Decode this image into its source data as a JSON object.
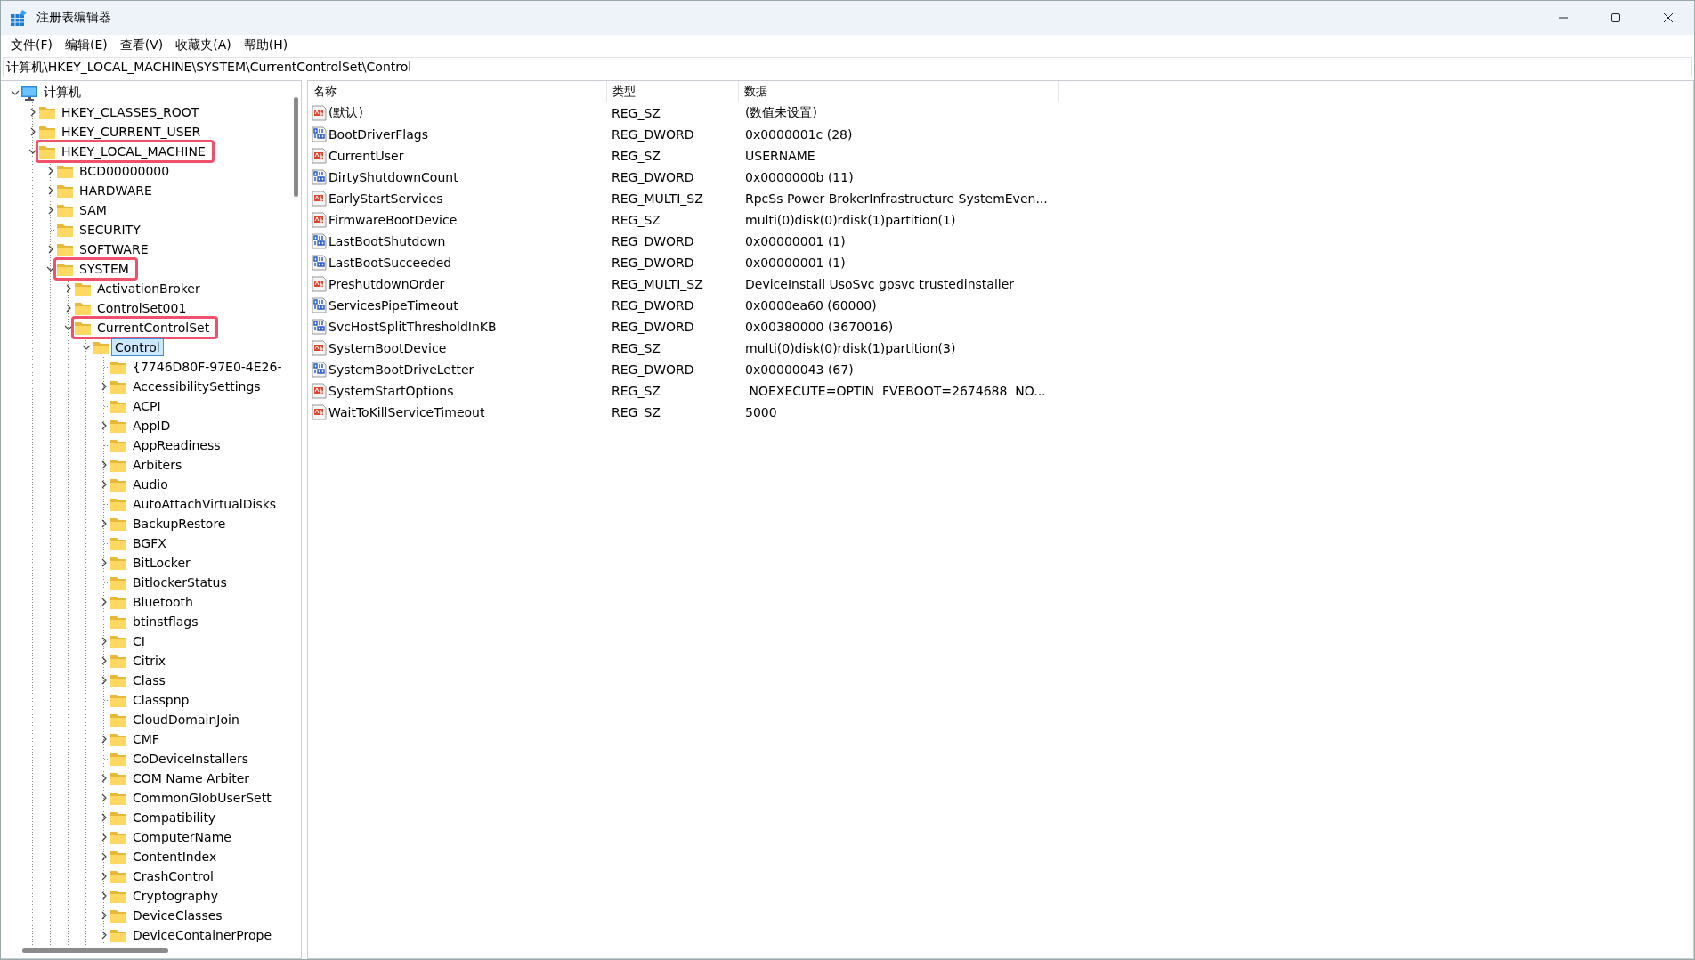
{
  "window": {
    "title": "注册表编辑器"
  },
  "menu": [
    "文件(F)",
    "编辑(E)",
    "查看(V)",
    "收藏夹(A)",
    "帮助(H)"
  ],
  "address_bar": {
    "value": "计算机\\HKEY_LOCAL_MACHINE\\SYSTEM\\CurrentControlSet\\Control"
  },
  "tree": [
    {
      "label": "计算机",
      "expandable": true,
      "expanded": true,
      "selected": false,
      "annotated": false,
      "children": [
        {
          "label": "HKEY_CLASSES_ROOT",
          "expandable": true,
          "expanded": false,
          "selected": false,
          "annotated": false
        },
        {
          "label": "HKEY_CURRENT_USER",
          "expandable": true,
          "expanded": false,
          "selected": false,
          "annotated": false
        },
        {
          "label": "HKEY_LOCAL_MACHINE",
          "expandable": true,
          "expanded": true,
          "selected": false,
          "annotated": true,
          "children": [
            {
              "label": "BCD00000000",
              "expandable": true,
              "expanded": false,
              "selected": false,
              "annotated": false
            },
            {
              "label": "HARDWARE",
              "expandable": true,
              "expanded": false,
              "selected": false,
              "annotated": false
            },
            {
              "label": "SAM",
              "expandable": true,
              "expanded": false,
              "selected": false,
              "annotated": false
            },
            {
              "label": "SECURITY",
              "expandable": false,
              "selected": false,
              "annotated": false
            },
            {
              "label": "SOFTWARE",
              "expandable": true,
              "expanded": false,
              "selected": false,
              "annotated": false
            },
            {
              "label": "SYSTEM",
              "expandable": true,
              "expanded": true,
              "selected": false,
              "annotated": true,
              "children": [
                {
                  "label": "ActivationBroker",
                  "expandable": true,
                  "expanded": false,
                  "selected": false,
                  "annotated": false
                },
                {
                  "label": "ControlSet001",
                  "expandable": true,
                  "expanded": false,
                  "selected": false,
                  "annotated": false
                },
                {
                  "label": "CurrentControlSet",
                  "expandable": true,
                  "expanded": true,
                  "selected": false,
                  "annotated": true,
                  "children": [
                    {
                      "label": "Control",
                      "expandable": true,
                      "expanded": true,
                      "selected": true,
                      "annotated": false,
                      "children": [
                        {
                          "label": "{7746D80F-97E0-4E26-",
                          "expandable": false,
                          "selected": false,
                          "annotated": false
                        },
                        {
                          "label": "AccessibilitySettings",
                          "expandable": true,
                          "expanded": false,
                          "selected": false,
                          "annotated": false
                        },
                        {
                          "label": "ACPI",
                          "expandable": false,
                          "selected": false,
                          "annotated": false
                        },
                        {
                          "label": "AppID",
                          "expandable": true,
                          "expanded": false,
                          "selected": false,
                          "annotated": false
                        },
                        {
                          "label": "AppReadiness",
                          "expandable": false,
                          "selected": false,
                          "annotated": false
                        },
                        {
                          "label": "Arbiters",
                          "expandable": true,
                          "expanded": false,
                          "selected": false,
                          "annotated": false
                        },
                        {
                          "label": "Audio",
                          "expandable": true,
                          "expanded": false,
                          "selected": false,
                          "annotated": false
                        },
                        {
                          "label": "AutoAttachVirtualDisks",
                          "expandable": false,
                          "selected": false,
                          "annotated": false
                        },
                        {
                          "label": "BackupRestore",
                          "expandable": true,
                          "expanded": false,
                          "selected": false,
                          "annotated": false
                        },
                        {
                          "label": "BGFX",
                          "expandable": false,
                          "selected": false,
                          "annotated": false
                        },
                        {
                          "label": "BitLocker",
                          "expandable": true,
                          "expanded": false,
                          "selected": false,
                          "annotated": false
                        },
                        {
                          "label": "BitlockerStatus",
                          "expandable": false,
                          "selected": false,
                          "annotated": false
                        },
                        {
                          "label": "Bluetooth",
                          "expandable": true,
                          "expanded": false,
                          "selected": false,
                          "annotated": false
                        },
                        {
                          "label": "btinstflags",
                          "expandable": false,
                          "selected": false,
                          "annotated": false
                        },
                        {
                          "label": "CI",
                          "expandable": true,
                          "expanded": false,
                          "selected": false,
                          "annotated": false
                        },
                        {
                          "label": "Citrix",
                          "expandable": true,
                          "expanded": false,
                          "selected": false,
                          "annotated": false
                        },
                        {
                          "label": "Class",
                          "expandable": true,
                          "expanded": false,
                          "selected": false,
                          "annotated": false
                        },
                        {
                          "label": "Classpnp",
                          "expandable": false,
                          "selected": false,
                          "annotated": false
                        },
                        {
                          "label": "CloudDomainJoin",
                          "expandable": false,
                          "selected": false,
                          "annotated": false
                        },
                        {
                          "label": "CMF",
                          "expandable": true,
                          "expanded": false,
                          "selected": false,
                          "annotated": false
                        },
                        {
                          "label": "CoDeviceInstallers",
                          "expandable": false,
                          "selected": false,
                          "annotated": false
                        },
                        {
                          "label": "COM Name Arbiter",
                          "expandable": true,
                          "expanded": false,
                          "selected": false,
                          "annotated": false
                        },
                        {
                          "label": "CommonGlobUserSett",
                          "expandable": true,
                          "expanded": false,
                          "selected": false,
                          "annotated": false
                        },
                        {
                          "label": "Compatibility",
                          "expandable": true,
                          "expanded": false,
                          "selected": false,
                          "annotated": false
                        },
                        {
                          "label": "ComputerName",
                          "expandable": true,
                          "expanded": false,
                          "selected": false,
                          "annotated": false
                        },
                        {
                          "label": "ContentIndex",
                          "expandable": true,
                          "expanded": false,
                          "selected": false,
                          "annotated": false
                        },
                        {
                          "label": "CrashControl",
                          "expandable": true,
                          "expanded": false,
                          "selected": false,
                          "annotated": false
                        },
                        {
                          "label": "Cryptography",
                          "expandable": true,
                          "expanded": false,
                          "selected": false,
                          "annotated": false
                        },
                        {
                          "label": "DeviceClasses",
                          "expandable": true,
                          "expanded": false,
                          "selected": false,
                          "annotated": false
                        },
                        {
                          "label": "DeviceContainerPrope",
                          "expandable": true,
                          "expanded": false,
                          "selected": false,
                          "annotated": false
                        }
                      ]
                    }
                  ]
                }
              ]
            }
          ]
        }
      ]
    }
  ],
  "values": {
    "columns": [
      "名称",
      "类型",
      "数据"
    ],
    "rows": [
      {
        "kind": "string",
        "name": "(默认)",
        "type": "REG_SZ",
        "data": "(数值未设置)"
      },
      {
        "kind": "binary",
        "name": "BootDriverFlags",
        "type": "REG_DWORD",
        "data": "0x0000001c (28)"
      },
      {
        "kind": "string",
        "name": "CurrentUser",
        "type": "REG_SZ",
        "data": "USERNAME"
      },
      {
        "kind": "binary",
        "name": "DirtyShutdownCount",
        "type": "REG_DWORD",
        "data": "0x0000000b (11)"
      },
      {
        "kind": "string",
        "name": "EarlyStartServices",
        "type": "REG_MULTI_SZ",
        "data": "RpcSs Power BrokerInfrastructure SystemEven..."
      },
      {
        "kind": "string",
        "name": "FirmwareBootDevice",
        "type": "REG_SZ",
        "data": "multi(0)disk(0)rdisk(1)partition(1)"
      },
      {
        "kind": "binary",
        "name": "LastBootShutdown",
        "type": "REG_DWORD",
        "data": "0x00000001 (1)"
      },
      {
        "kind": "binary",
        "name": "LastBootSucceeded",
        "type": "REG_DWORD",
        "data": "0x00000001 (1)"
      },
      {
        "kind": "string",
        "name": "PreshutdownOrder",
        "type": "REG_MULTI_SZ",
        "data": "DeviceInstall UsoSvc gpsvc trustedinstaller"
      },
      {
        "kind": "binary",
        "name": "ServicesPipeTimeout",
        "type": "REG_DWORD",
        "data": "0x0000ea60 (60000)"
      },
      {
        "kind": "binary",
        "name": "SvcHostSplitThresholdInKB",
        "type": "REG_DWORD",
        "data": "0x00380000 (3670016)"
      },
      {
        "kind": "string",
        "name": "SystemBootDevice",
        "type": "REG_SZ",
        "data": "multi(0)disk(0)rdisk(1)partition(3)"
      },
      {
        "kind": "binary",
        "name": "SystemBootDriveLetter",
        "type": "REG_DWORD",
        "data": "0x00000043 (67)"
      },
      {
        "kind": "string",
        "name": "SystemStartOptions",
        "type": "REG_SZ",
        "data": " NOEXECUTE=OPTIN  FVEBOOT=2674688  NO..."
      },
      {
        "kind": "string",
        "name": "WaitToKillServiceTimeout",
        "type": "REG_SZ",
        "data": "5000"
      }
    ]
  }
}
